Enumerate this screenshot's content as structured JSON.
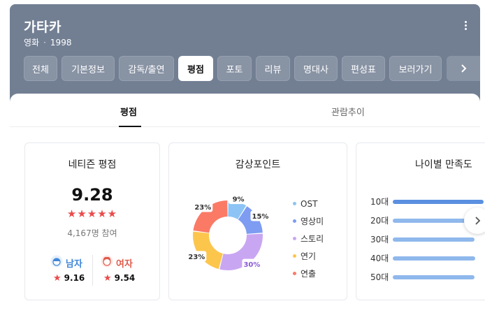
{
  "movie": {
    "title": "가타카",
    "genre": "영화",
    "separator": "·",
    "year": "1998"
  },
  "tabs": [
    {
      "label": "전체",
      "active": false
    },
    {
      "label": "기본정보",
      "active": false
    },
    {
      "label": "감독/출연",
      "active": false
    },
    {
      "label": "평점",
      "active": true
    },
    {
      "label": "포토",
      "active": false
    },
    {
      "label": "리뷰",
      "active": false
    },
    {
      "label": "명대사",
      "active": false
    },
    {
      "label": "편성표",
      "active": false
    },
    {
      "label": "보러가기",
      "active": false
    }
  ],
  "icons": {
    "more": "more-vertical-icon",
    "tabs_next": "chevron-right-icon",
    "cards_next": "chevron-right-icon",
    "male": "male-avatar-icon",
    "female": "female-avatar-icon",
    "star": "star-icon"
  },
  "subtabs": [
    {
      "label": "평점",
      "active": true
    },
    {
      "label": "관람추이",
      "active": false
    }
  ],
  "netizen": {
    "title": "네티즌 평점",
    "score": "9.28",
    "stars_text": "★★★★★",
    "stars_value": 5,
    "participants": "4,167명 참여",
    "male": {
      "label": "남자",
      "star": "★",
      "score": "9.16"
    },
    "female": {
      "label": "여자",
      "star": "★",
      "score": "9.54"
    }
  },
  "points": {
    "title": "감상포인트"
  },
  "age": {
    "title": "나이별 만족도"
  },
  "colors": {
    "header_bg": "#727f93",
    "male": "#3e86d8",
    "female": "#e05b4c",
    "star": "#e94b4b"
  },
  "chart_data": [
    {
      "type": "pie",
      "title": "감상포인트",
      "categories": [
        "OST",
        "영상미",
        "스토리",
        "연기",
        "연출"
      ],
      "values": [
        9,
        15,
        30,
        23,
        23
      ],
      "labels": [
        "9%",
        "15%",
        "30%",
        "23%",
        "23%"
      ],
      "colors": [
        "#8dc4f5",
        "#7d9cf2",
        "#c9a6f2",
        "#fcc64d",
        "#fa7a66"
      ],
      "legend": "right"
    },
    {
      "type": "bar",
      "title": "나이별 만족도",
      "categories": [
        "10대",
        "20대",
        "30대",
        "40대",
        "50대"
      ],
      "values": [
        1,
        0.9,
        0.9,
        0.91,
        0.9
      ],
      "colors": [
        "#5b8fe0",
        "#8fb8ec",
        "#8fb8ec",
        "#8fb8ec",
        "#8fb8ec"
      ]
    }
  ]
}
